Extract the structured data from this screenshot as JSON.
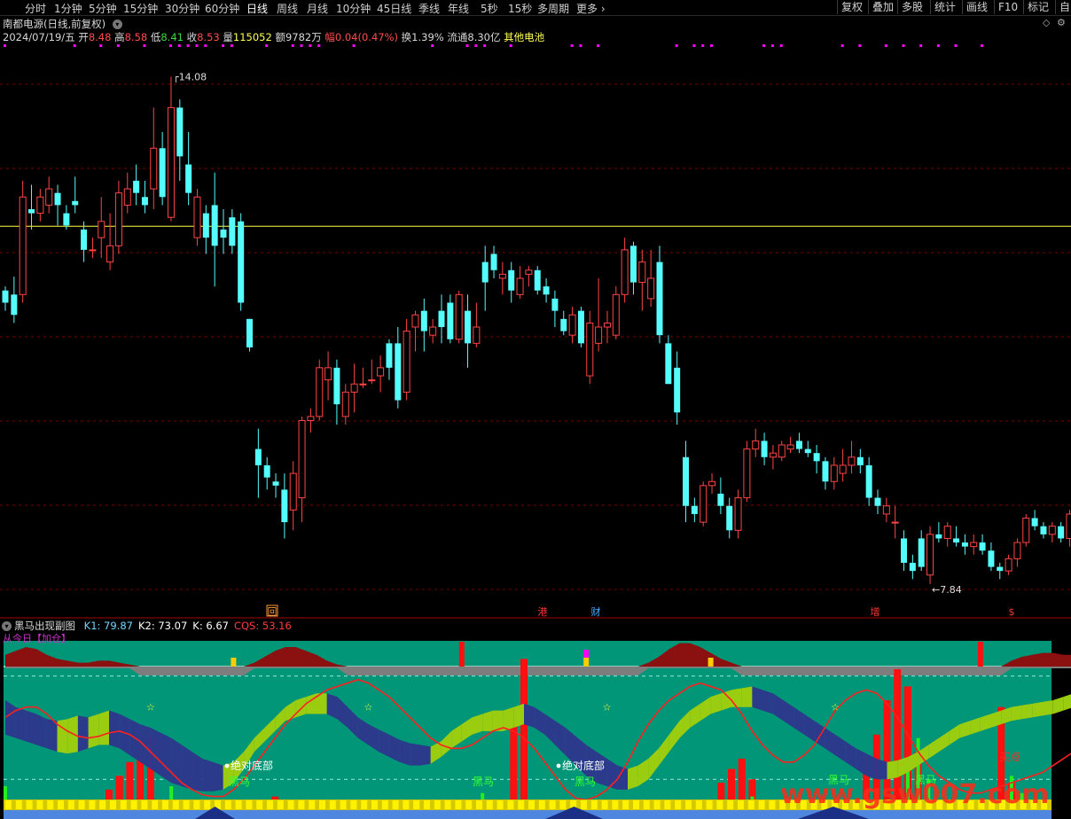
{
  "toolbar": {
    "timeframes": [
      "分时",
      "1分钟",
      "5分钟",
      "15分钟",
      "30分钟",
      "60分钟",
      "日线",
      "周线",
      "月线",
      "10分钟",
      "45日线",
      "季线",
      "年线",
      "5秒",
      "15秒",
      "多周期"
    ],
    "active": "日线",
    "more_label": "更多",
    "right_buttons": [
      "复权",
      "叠加",
      "多股",
      "统计",
      "画线",
      "F10",
      "标记",
      "自"
    ]
  },
  "stock": {
    "title": "南都电源(日线,前复权)",
    "date": "2024/07/19/五",
    "open_label": "开",
    "open": "8.48",
    "high_label": "高",
    "high": "8.58",
    "low_label": "低",
    "low": "8.41",
    "close_label": "收",
    "close": "8.53",
    "vol_label": "量",
    "vol": "115052",
    "amount_label": "额",
    "amount": "9782万",
    "chg_label": "幅",
    "chg": "0.04(0.47%)",
    "turnover": "换1.39%",
    "float_label": "流通",
    "float_val": "8.30亿",
    "sector": "其他电池"
  },
  "colors": {
    "up": "#ff4444",
    "down": "#54fcfc",
    "grid": "#7a0000",
    "magenta": "#ff00ff",
    "panel_bg": "#00937a",
    "yellow_line": "#ffff44"
  },
  "chart_data": [
    {
      "type": "candlestick",
      "title": "南都电源(日线,前复权)",
      "series_note": "daily OHLC, approximate",
      "ylim": [
        7.5,
        14.5
      ],
      "horizontal_line": 12.24,
      "annotations": {
        "high": "14.08",
        "low": "7.84"
      },
      "event_markers": [
        "回",
        "港",
        "财",
        "增",
        "$"
      ],
      "ohlc": [
        [
          11.45,
          11.5,
          11.2,
          11.3
        ],
        [
          11.4,
          11.62,
          11.05,
          11.15
        ],
        [
          11.4,
          12.8,
          11.3,
          12.6
        ],
        [
          12.45,
          12.75,
          12.2,
          12.4
        ],
        [
          12.4,
          12.7,
          12.3,
          12.6
        ],
        [
          12.5,
          12.85,
          12.4,
          12.7
        ],
        [
          12.65,
          12.75,
          12.25,
          12.5
        ],
        [
          12.4,
          12.5,
          12.2,
          12.25
        ],
        [
          12.55,
          12.85,
          12.4,
          12.5
        ],
        [
          12.2,
          12.3,
          11.8,
          11.95
        ],
        [
          11.95,
          12.1,
          11.85,
          11.95
        ],
        [
          12.1,
          12.6,
          11.85,
          12.3
        ],
        [
          11.8,
          12.4,
          11.7,
          12.0
        ],
        [
          12.0,
          12.8,
          11.9,
          12.65
        ],
        [
          12.5,
          12.9,
          12.4,
          12.7
        ],
        [
          12.8,
          13.0,
          12.5,
          12.65
        ],
        [
          12.6,
          12.8,
          12.4,
          12.5
        ],
        [
          12.7,
          13.7,
          12.45,
          13.2
        ],
        [
          13.2,
          13.4,
          12.5,
          12.6
        ],
        [
          12.35,
          14.08,
          12.3,
          13.7
        ],
        [
          13.7,
          13.8,
          12.8,
          13.1
        ],
        [
          13.0,
          13.4,
          12.5,
          12.65
        ],
        [
          12.1,
          12.7,
          12.0,
          12.6
        ],
        [
          12.4,
          12.5,
          11.9,
          12.1
        ],
        [
          12.5,
          12.9,
          11.5,
          12.0
        ],
        [
          12.2,
          12.45,
          11.9,
          12.1
        ],
        [
          12.35,
          12.45,
          11.9,
          12.0
        ],
        [
          12.3,
          12.4,
          11.2,
          11.3
        ],
        [
          11.1,
          11.1,
          10.7,
          10.75
        ],
        [
          9.5,
          9.75,
          8.9,
          9.3
        ],
        [
          9.3,
          9.4,
          9.0,
          9.15
        ],
        [
          9.1,
          9.2,
          8.9,
          9.05
        ],
        [
          9.0,
          9.2,
          8.4,
          8.6
        ],
        [
          8.75,
          9.35,
          8.5,
          9.2
        ],
        [
          8.9,
          9.9,
          8.6,
          9.85
        ],
        [
          9.85,
          10.0,
          9.7,
          9.9
        ],
        [
          9.9,
          10.6,
          9.85,
          10.5
        ],
        [
          10.35,
          10.7,
          10.1,
          10.5
        ],
        [
          10.5,
          10.6,
          9.8,
          10.05
        ],
        [
          9.9,
          10.3,
          9.8,
          10.2
        ],
        [
          10.2,
          10.55,
          9.95,
          10.3
        ],
        [
          10.3,
          10.5,
          10.25,
          10.3
        ],
        [
          10.35,
          10.6,
          10.3,
          10.35
        ],
        [
          10.4,
          10.65,
          10.2,
          10.5
        ],
        [
          10.8,
          10.85,
          10.35,
          10.5
        ],
        [
          10.8,
          11.0,
          10.0,
          10.1
        ],
        [
          10.2,
          11.1,
          10.1,
          10.95
        ],
        [
          11.0,
          11.2,
          10.7,
          11.15
        ],
        [
          11.2,
          11.35,
          10.7,
          10.95
        ],
        [
          10.9,
          11.1,
          10.8,
          11.0
        ],
        [
          11.2,
          11.4,
          10.8,
          11.0
        ],
        [
          11.3,
          11.4,
          10.8,
          10.85
        ],
        [
          10.85,
          11.45,
          10.8,
          11.4
        ],
        [
          11.2,
          11.4,
          10.5,
          10.8
        ],
        [
          10.8,
          11.3,
          10.75,
          11.0
        ],
        [
          11.8,
          12.0,
          11.2,
          11.55
        ],
        [
          11.9,
          12.0,
          11.6,
          11.7
        ],
        [
          11.6,
          11.8,
          11.4,
          11.65
        ],
        [
          11.7,
          11.8,
          11.3,
          11.45
        ],
        [
          11.4,
          11.75,
          11.35,
          11.6
        ],
        [
          11.65,
          11.75,
          11.5,
          11.7
        ],
        [
          11.7,
          11.75,
          11.4,
          11.45
        ],
        [
          11.5,
          11.6,
          11.3,
          11.4
        ],
        [
          11.35,
          11.45,
          11.0,
          11.2
        ],
        [
          11.1,
          11.2,
          10.9,
          10.95
        ],
        [
          10.9,
          11.25,
          10.8,
          11.15
        ],
        [
          11.2,
          11.25,
          10.75,
          10.8
        ],
        [
          10.4,
          11.2,
          10.3,
          11.05
        ],
        [
          10.8,
          11.6,
          10.7,
          11.0
        ],
        [
          11.0,
          11.2,
          10.8,
          11.05
        ],
        [
          10.9,
          11.5,
          10.85,
          11.4
        ],
        [
          11.4,
          12.1,
          11.3,
          11.95
        ],
        [
          12.0,
          12.05,
          11.4,
          11.55
        ],
        [
          11.55,
          11.95,
          11.2,
          11.8
        ],
        [
          11.35,
          11.95,
          11.25,
          11.6
        ],
        [
          11.8,
          12.0,
          10.8,
          10.9
        ],
        [
          10.8,
          10.9,
          10.3,
          10.3
        ],
        [
          10.5,
          10.7,
          9.8,
          9.95
        ],
        [
          9.4,
          9.6,
          8.6,
          8.8
        ],
        [
          8.8,
          8.9,
          8.6,
          8.7
        ],
        [
          8.6,
          9.1,
          8.55,
          9.05
        ],
        [
          9.05,
          9.2,
          8.95,
          9.1
        ],
        [
          8.95,
          9.15,
          8.7,
          8.8
        ],
        [
          8.8,
          8.9,
          8.4,
          8.5
        ],
        [
          8.5,
          9.0,
          8.4,
          8.9
        ],
        [
          8.9,
          9.6,
          8.85,
          9.5
        ],
        [
          9.5,
          9.75,
          9.4,
          9.6
        ],
        [
          9.6,
          9.7,
          9.3,
          9.4
        ],
        [
          9.4,
          9.55,
          9.25,
          9.45
        ],
        [
          9.4,
          9.6,
          9.35,
          9.55
        ],
        [
          9.5,
          9.65,
          9.45,
          9.55
        ],
        [
          9.6,
          9.7,
          9.45,
          9.5
        ],
        [
          9.5,
          9.6,
          9.4,
          9.45
        ],
        [
          9.45,
          9.55,
          9.2,
          9.35
        ],
        [
          9.35,
          9.4,
          9.0,
          9.1
        ],
        [
          9.1,
          9.4,
          9.0,
          9.3
        ],
        [
          9.2,
          9.5,
          9.1,
          9.3
        ],
        [
          9.3,
          9.6,
          9.2,
          9.4
        ],
        [
          9.4,
          9.5,
          9.2,
          9.3
        ],
        [
          9.3,
          9.4,
          8.8,
          8.9
        ],
        [
          8.9,
          9.0,
          8.7,
          8.8
        ],
        [
          8.7,
          8.9,
          8.6,
          8.8
        ],
        [
          8.6,
          8.8,
          8.4,
          8.6
        ],
        [
          8.4,
          8.5,
          8.0,
          8.1
        ],
        [
          8.1,
          8.2,
          7.9,
          8.0
        ],
        [
          8.4,
          8.5,
          8.0,
          8.05
        ],
        [
          7.95,
          8.55,
          7.84,
          8.45
        ],
        [
          8.45,
          8.6,
          8.35,
          8.4
        ],
        [
          8.4,
          8.6,
          8.3,
          8.55
        ],
        [
          8.4,
          8.55,
          8.3,
          8.35
        ],
        [
          8.35,
          8.45,
          8.2,
          8.3
        ],
        [
          8.3,
          8.45,
          8.2,
          8.35
        ],
        [
          8.35,
          8.45,
          8.2,
          8.25
        ],
        [
          8.25,
          8.35,
          8.0,
          8.05
        ],
        [
          8.05,
          8.1,
          7.9,
          8.0
        ],
        [
          8.0,
          8.2,
          7.95,
          8.15
        ],
        [
          8.15,
          8.4,
          8.05,
          8.35
        ],
        [
          8.35,
          8.7,
          8.3,
          8.65
        ],
        [
          8.65,
          8.75,
          8.5,
          8.55
        ],
        [
          8.55,
          8.6,
          8.4,
          8.45
        ],
        [
          8.45,
          8.6,
          8.35,
          8.55
        ],
        [
          8.55,
          8.6,
          8.35,
          8.4
        ],
        [
          8.4,
          8.75,
          8.3,
          8.7
        ],
        [
          8.48,
          8.58,
          8.41,
          8.53
        ]
      ]
    },
    {
      "type": "area",
      "title": "黑马出现副图",
      "params": [
        {
          "name": "K1",
          "value": "79.87",
          "color": "#6fd8ff"
        },
        {
          "name": "K2",
          "value": "73.07",
          "color": "#ffffff"
        },
        {
          "name": "K",
          "value": "6.67",
          "color": "#ffffff"
        },
        {
          "name": "CQS",
          "value": "53.16",
          "color": "#ff3b3b"
        }
      ],
      "indicator_note": "从今日【加仓】",
      "labels": [
        "绝对底部",
        "绝对底部",
        "黑马",
        "黑马",
        "黑马",
        "黑马",
        "黑马"
      ],
      "red_label": "买点",
      "watermark": "www.gsw007.com",
      "ylim": [
        0,
        100
      ],
      "reference_lines": [
        20,
        80,
        50
      ],
      "upper_band": [
        66,
        62,
        60,
        58,
        55,
        54,
        55,
        57,
        56,
        58,
        60,
        58,
        55,
        52,
        50,
        47,
        44,
        40,
        36,
        32,
        30,
        28,
        30,
        36,
        44,
        50,
        56,
        62,
        66,
        68,
        70,
        70,
        68,
        62,
        56,
        52,
        49,
        46,
        43,
        41,
        40,
        39,
        42,
        48,
        52,
        56,
        58,
        60,
        60,
        62,
        64,
        62,
        58,
        54,
        50,
        45,
        40,
        36,
        32,
        28,
        26,
        28,
        32,
        38,
        46,
        54,
        60,
        64,
        68,
        70,
        72,
        73,
        74,
        72,
        70,
        66,
        62,
        58,
        54,
        50,
        46,
        42,
        38,
        35,
        32,
        30,
        31,
        33,
        36,
        40,
        44,
        48,
        52,
        54,
        56,
        58,
        60,
        62,
        63,
        64,
        65,
        66,
        68,
        70,
        72,
        73
      ],
      "lower_band": [
        46,
        44,
        42,
        40,
        38,
        36,
        35,
        36,
        38,
        40,
        40,
        38,
        34,
        30,
        26,
        22,
        18,
        16,
        14,
        13,
        13,
        14,
        18,
        26,
        36,
        42,
        48,
        54,
        56,
        58,
        58,
        58,
        55,
        50,
        44,
        40,
        36,
        33,
        30,
        28,
        28,
        29,
        33,
        38,
        42,
        46,
        48,
        48,
        48,
        50,
        52,
        50,
        46,
        40,
        34,
        28,
        22,
        18,
        16,
        14,
        14,
        16,
        20,
        28,
        36,
        44,
        50,
        54,
        58,
        60,
        62,
        62,
        62,
        60,
        58,
        54,
        50,
        46,
        42,
        38,
        34,
        30,
        26,
        22,
        20,
        20,
        21,
        24,
        28,
        32,
        36,
        40,
        44,
        46,
        48,
        50,
        52,
        54,
        55,
        56,
        57,
        58,
        60,
        62,
        64,
        65
      ],
      "red_line": [
        56,
        60,
        62,
        62,
        58,
        52,
        48,
        45,
        44,
        45,
        47,
        48,
        46,
        42,
        36,
        30,
        24,
        18,
        14,
        11,
        10,
        10,
        14,
        20,
        28,
        36,
        44,
        52,
        58,
        64,
        68,
        72,
        74,
        76,
        78,
        76,
        72,
        68,
        62,
        56,
        50,
        44,
        40,
        38,
        38,
        40,
        44,
        48,
        50,
        48,
        44,
        38,
        30,
        22,
        14,
        9,
        8,
        10,
        14,
        20,
        30,
        42,
        52,
        60,
        66,
        70,
        74,
        76,
        74,
        72,
        66,
        58,
        48,
        40,
        34,
        30,
        30,
        34,
        40,
        50,
        60,
        66,
        70,
        72,
        70,
        64,
        56,
        46,
        36,
        28,
        22,
        18,
        14,
        12,
        12,
        14,
        16,
        18,
        20,
        22,
        24,
        28,
        32,
        36,
        40,
        46
      ],
      "tops": [
        6,
        8,
        10,
        9,
        6,
        4,
        3,
        2,
        2,
        3,
        3,
        2,
        1,
        0,
        0,
        0,
        0,
        0,
        0,
        0,
        0,
        0,
        0,
        0,
        2,
        5,
        8,
        10,
        10,
        8,
        6,
        3,
        1,
        0,
        0,
        0,
        0,
        0,
        0,
        0,
        0,
        0,
        0,
        0,
        0,
        0,
        0,
        0,
        0,
        0,
        0,
        0,
        0,
        0,
        0,
        0,
        0,
        0,
        0,
        0,
        0,
        0,
        2,
        5,
        9,
        12,
        12,
        10,
        7,
        4,
        2,
        0,
        0,
        0,
        0,
        0,
        0,
        0,
        0,
        0,
        0,
        0,
        0,
        0,
        0,
        0,
        0,
        0,
        0,
        0,
        0,
        0,
        0,
        0,
        0,
        0,
        0,
        3,
        5,
        6,
        7,
        7,
        6,
        6,
        6,
        6
      ],
      "red_bars": [
        [
          9,
          6
        ],
        [
          10,
          14
        ],
        [
          11,
          22
        ],
        [
          12,
          30
        ],
        [
          13,
          38
        ],
        [
          14,
          46
        ],
        [
          26,
          10
        ],
        [
          49,
          58
        ],
        [
          50,
          90
        ],
        [
          51,
          6
        ],
        [
          69,
          18
        ],
        [
          70,
          26
        ],
        [
          71,
          32
        ],
        [
          72,
          20
        ],
        [
          83,
          34
        ],
        [
          84,
          46
        ],
        [
          85,
          66
        ],
        [
          86,
          84
        ],
        [
          87,
          74
        ],
        [
          88,
          36
        ],
        [
          96,
          62
        ],
        [
          97,
          18
        ]
      ],
      "green_bars": [
        [
          0,
          16
        ],
        [
          1,
          8
        ],
        [
          15,
          8
        ],
        [
          16,
          16
        ],
        [
          44,
          6
        ],
        [
          45,
          8
        ],
        [
          46,
          12
        ],
        [
          72,
          10
        ],
        [
          87,
          30
        ],
        [
          88,
          44
        ],
        [
          89,
          20
        ],
        [
          97,
          22
        ],
        [
          98,
          12
        ]
      ],
      "mini_stars": [
        14,
        35,
        58,
        80
      ]
    }
  ]
}
